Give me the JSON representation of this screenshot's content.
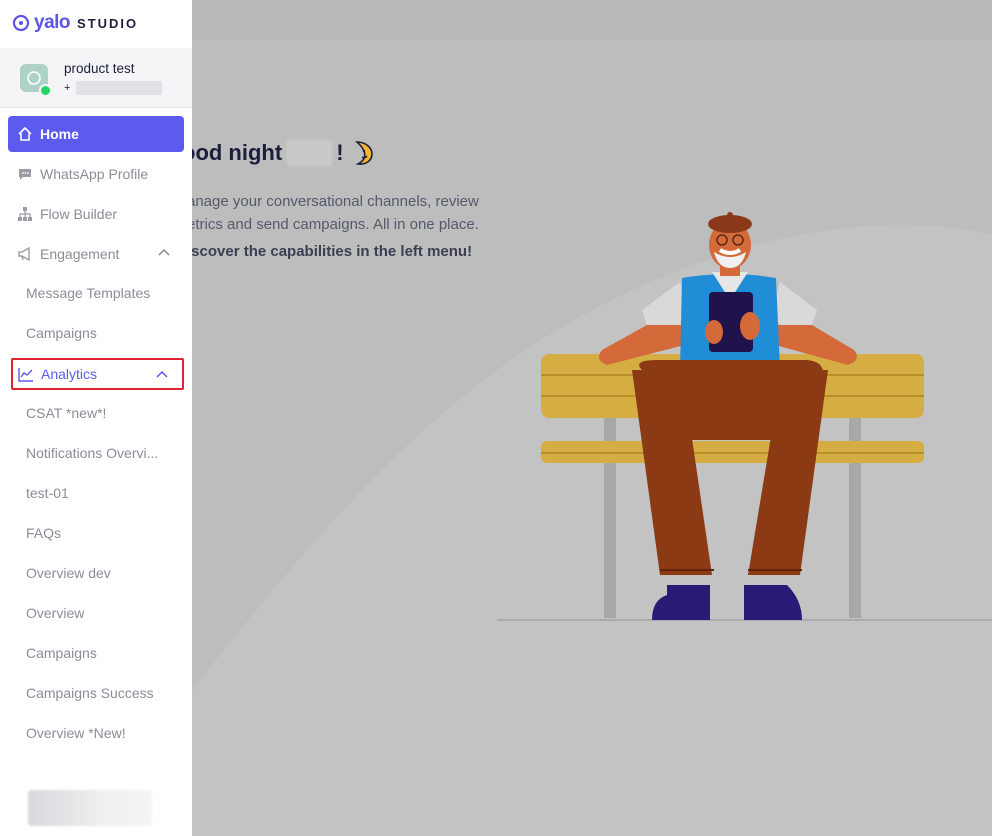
{
  "brand": {
    "logo_text": "yalo",
    "product": "STUDIO"
  },
  "account": {
    "name": "product test",
    "phone_prefix": "+"
  },
  "nav": {
    "home": "Home",
    "whatsapp_profile": "WhatsApp Profile",
    "flow_builder": "Flow Builder",
    "engagement": "Engagement",
    "engagement_items": [
      "Message Templates",
      "Campaigns"
    ],
    "analytics": "Analytics",
    "analytics_items": [
      "CSAT *new*!",
      "Notifications Overvi...",
      "test-01",
      "FAQs",
      "Overview dev",
      "Overview",
      "Campaigns",
      "Campaigns Success",
      "Overview *New!"
    ]
  },
  "main": {
    "greeting": "ood night",
    "greeting_suffix": "!",
    "description": "anage your conversational channels, review etrics and send campaigns. All in one place.",
    "cta": "iscover the capabilities in the left menu!"
  },
  "colors": {
    "accent": "#5b5bf0",
    "highlight_border": "#e0232e",
    "sidebar_text": "#8a8d99",
    "background": "#bdbdbd"
  }
}
